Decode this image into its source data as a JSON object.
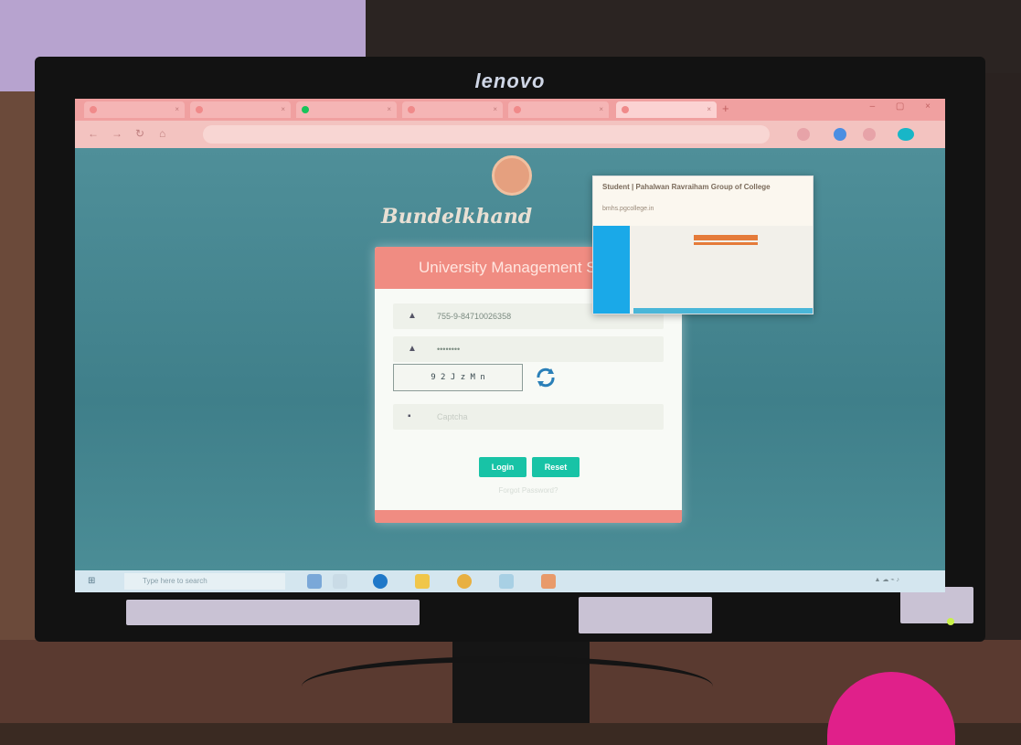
{
  "monitor": {
    "brand": "lenovo"
  },
  "browser": {
    "tabs": [
      "",
      "",
      "",
      "",
      "",
      ""
    ],
    "url": "",
    "preview": {
      "title": "Student | Pahalwan Ravraiham Group of College",
      "url": "bmhs.pgcollege.in"
    }
  },
  "page": {
    "college_name": "Bundelkhand",
    "card_title": "University Management System",
    "username_value": "755-9-84710026358",
    "password_value": "••••••••",
    "captcha_text": "9 2 J z M n",
    "answer_placeholder": "Captcha",
    "login_label": "Login",
    "reset_label": "Reset",
    "forgot_label": "Forgot Password?",
    "footer_text": ""
  },
  "taskbar": {
    "search_placeholder": "Type here to search"
  },
  "colors": {
    "screen_bg": "#4a8c96",
    "card_header": "#f08c82",
    "button": "#18c3a6"
  },
  "icons": [
    "refresh-icon",
    "user-icon",
    "lock-icon",
    "key-icon",
    "windows-start-icon",
    "search-icon"
  ]
}
